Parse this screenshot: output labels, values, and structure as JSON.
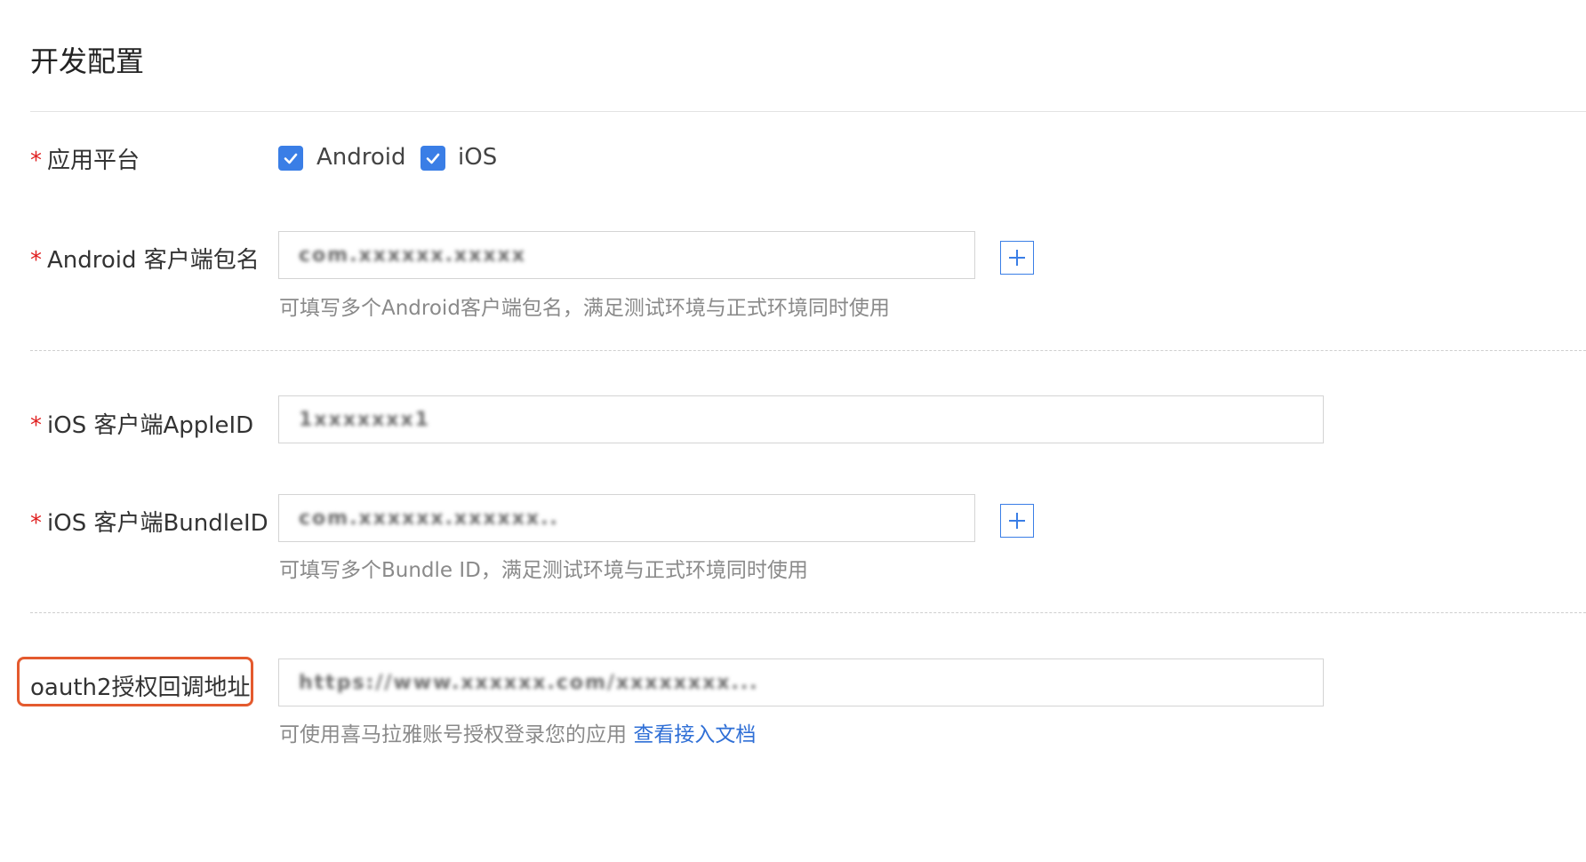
{
  "section": {
    "title": "开发配置"
  },
  "platform": {
    "required_mark": "*",
    "label": "应用平台",
    "options": [
      {
        "label": "Android",
        "checked": true
      },
      {
        "label": "iOS",
        "checked": true
      }
    ]
  },
  "android_package": {
    "required_mark": "*",
    "label": "Android 客户端包名",
    "value": "com.xxxxxx.xxxxx",
    "hint": "可填写多个Android客户端包名，满足测试环境与正式环境同时使用"
  },
  "ios_appleid": {
    "required_mark": "*",
    "label": "iOS 客户端AppleID",
    "value": "1xxxxxxx1"
  },
  "ios_bundleid": {
    "required_mark": "*",
    "label": "iOS 客户端BundleID",
    "value": "com.xxxxxx.xxxxxx..",
    "hint": "可填写多个Bundle ID，满足测试环境与正式环境同时使用"
  },
  "oauth": {
    "label": "oauth2授权回调地址",
    "value": "https://www.xxxxxx.com/xxxxxxxx...",
    "hint_text": "可使用喜马拉雅账号授权登录您的应用",
    "hint_link": "查看接入文档",
    "highlight_color": "#e45a2e"
  },
  "colors": {
    "accent": "#3a7ee6",
    "required": "#e02020"
  }
}
